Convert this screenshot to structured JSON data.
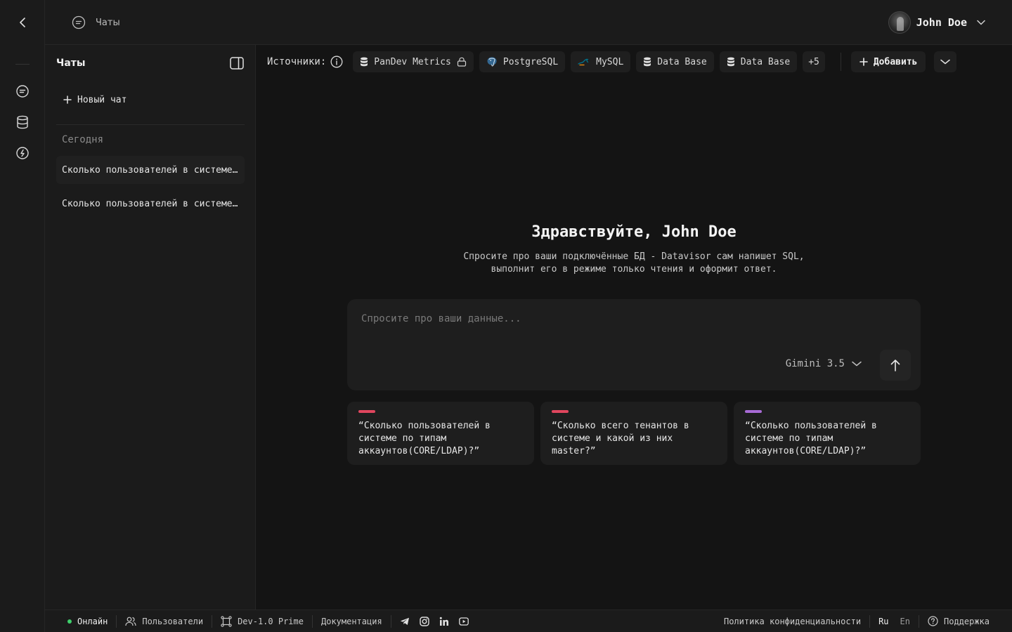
{
  "colors": {
    "online": "#3ecf6b",
    "card_bar_1": "#e0465e",
    "card_bar_2": "#e0465e",
    "card_bar_3": "#a86bd6"
  },
  "rail": {
    "icons": [
      "back-icon",
      "chat-icon",
      "database-icon",
      "plugin-icon"
    ]
  },
  "header": {
    "breadcrumb": "Чаты",
    "user_name": "John Doe"
  },
  "sidebar": {
    "title": "Чаты",
    "new_chat": "Новый чат",
    "group_label": "Сегодня",
    "chats": [
      "Сколько пользователей в системе по типам аккаунтов",
      "Сколько пользователей в системе по типам аккаунтов"
    ]
  },
  "sources": {
    "label": "Источники:",
    "chips": [
      "PanDev Metrics",
      "PostgreSQL",
      "MySQL",
      "Data Base",
      "Data Base"
    ],
    "more": "+5",
    "add": "Добавить"
  },
  "hero": {
    "title": "Здравствуйте, John Doe",
    "line1": "Спросите про ваши подключённые БД - Datavisor сам напишет SQL,",
    "line2": "выполнит его в режиме только чтения и оформит ответ."
  },
  "composer": {
    "placeholder": "Спросите про ваши данные...",
    "model": "Gimini 3.5"
  },
  "suggestions": [
    "“Сколько пользователей в системе по типам аккаунтов(CORE/LDAP)?”",
    "“Сколько всего тенантов в системе и какой из них master?”",
    "“Сколько пользователей в системе по типам аккаунтов(CORE/LDAP)?”"
  ],
  "footer": {
    "status": "Онлайн",
    "users": "Пользователи",
    "version": "Dev-1.0 Prime",
    "docs": "Документация",
    "privacy": "Политика конфиденциальности",
    "lang_ru": "Ru",
    "lang_en": "En",
    "support": "Поддержка"
  }
}
